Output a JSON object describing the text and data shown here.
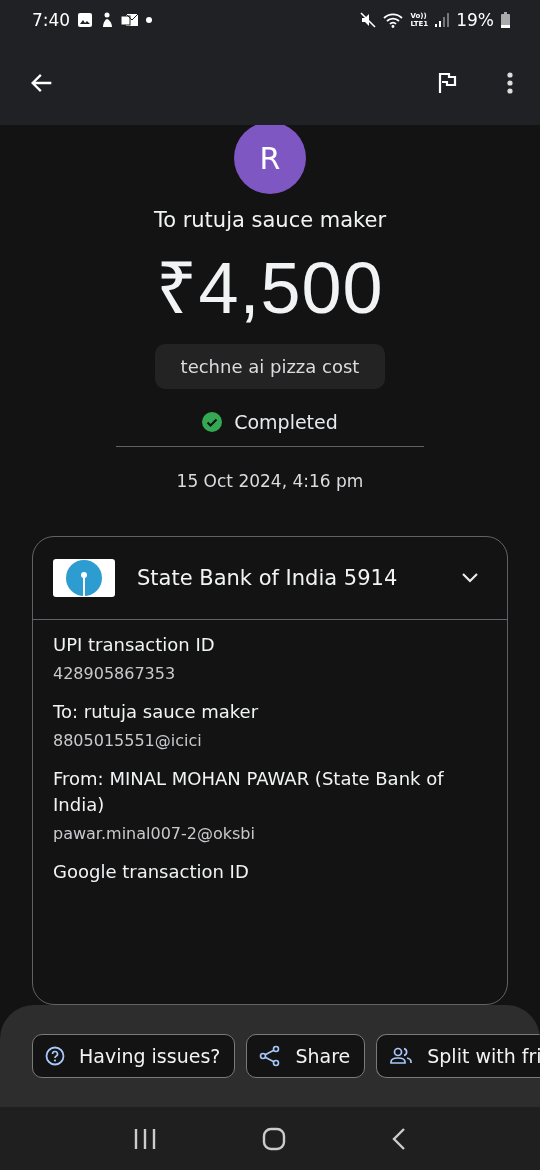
{
  "status_bar": {
    "time": "7:40",
    "volte": "Vo))",
    "lte": "LTE1",
    "battery": "19%"
  },
  "payment": {
    "avatar_letter": "R",
    "recipient": "To rutuja sauce maker",
    "amount": "₹4,500",
    "note": "techne ai pizza cost",
    "status": "Completed",
    "date": "15 Oct 2024, 4:16 pm"
  },
  "account": {
    "bank": "State Bank of India 5914",
    "expanded": true,
    "details": [
      {
        "label": "UPI transaction ID",
        "value": "428905867353"
      },
      {
        "label": "To: rutuja sauce maker",
        "value": "8805015551@icici"
      },
      {
        "label": "From: MINAL MOHAN PAWAR (State Bank of India)",
        "value": "pawar.minal007-2@oksbi"
      },
      {
        "label": "Google transaction ID"
      }
    ]
  },
  "actions": [
    {
      "kind": "help",
      "label": "Having issues?"
    },
    {
      "kind": "share",
      "label": "Share"
    },
    {
      "kind": "people",
      "label": "Split with fri"
    }
  ]
}
